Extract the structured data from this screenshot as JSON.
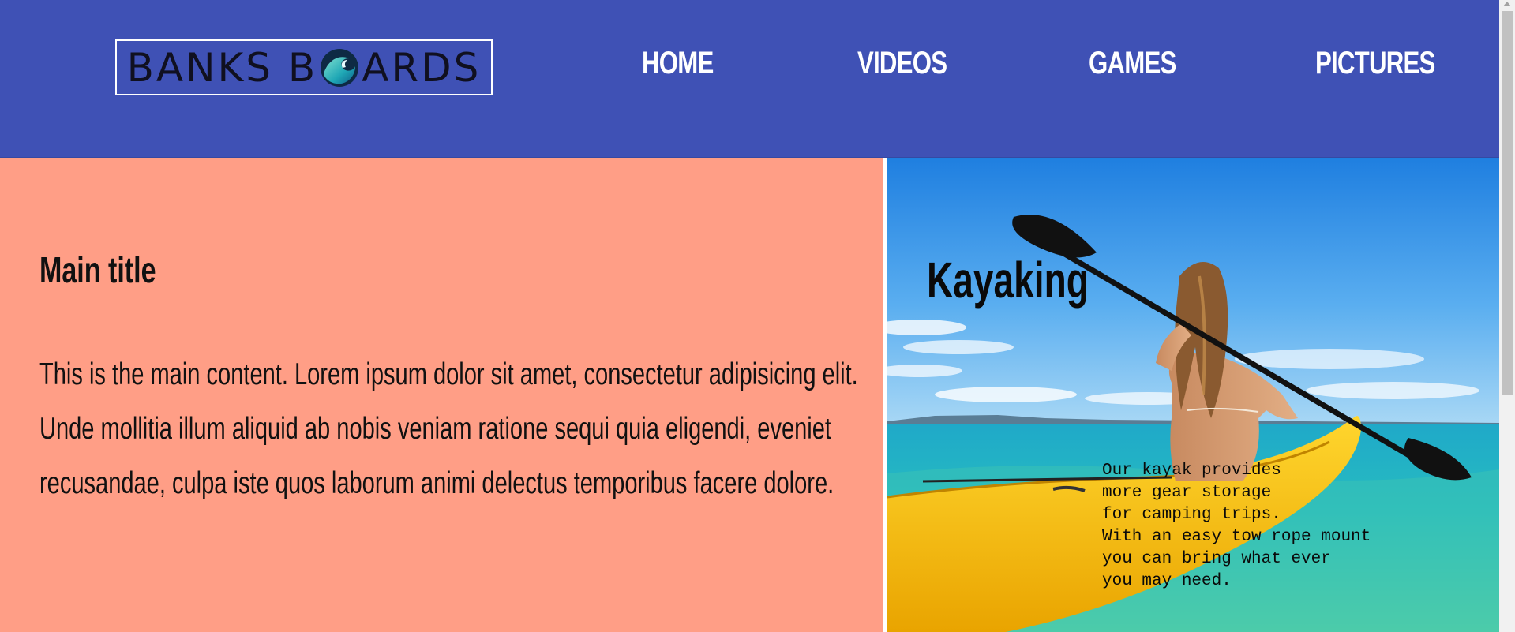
{
  "header": {
    "logo": {
      "text_left": "BANKS B",
      "text_right": "ARDS",
      "alt": "BANKS BOARDS"
    },
    "nav": [
      {
        "label": "HOME"
      },
      {
        "label": "VIDEOS"
      },
      {
        "label": "GAMES"
      },
      {
        "label": "PICTURES"
      }
    ],
    "colors": {
      "background": "#3f51b5",
      "nav_text": "#ffffff"
    }
  },
  "main": {
    "title": "Main title",
    "content": "This is the main content. Lorem ipsum dolor sit amet, consectetur adipisicing elit. Unde mollitia illum aliquid ab nobis veniam ratione sequi quia eligendi, eveniet recusandae, culpa iste quos laborum animi delectus temporibus facere dolore.",
    "background": "#ff9e86"
  },
  "feature": {
    "title": "Kayaking",
    "description": "Our kayak provides\nmore gear storage\nfor camping trips.\nWith an easy tow rope mount\nyou can bring what ever\nyou may need.",
    "image_subject": "woman paddling yellow kayak on turquoise ocean"
  },
  "icons": {
    "logo_wave": "wave-icon",
    "scroll_up": "scroll-up-arrow-icon"
  }
}
